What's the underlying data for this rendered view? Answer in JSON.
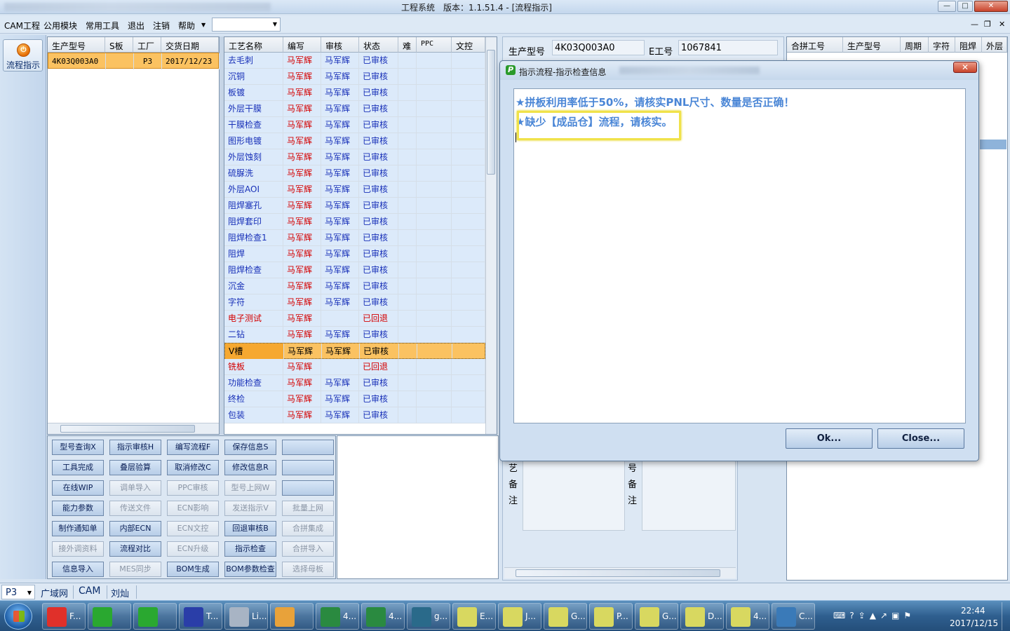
{
  "window": {
    "title": "工程系统　版本：1.1.51.4 - [流程指示]"
  },
  "menu": {
    "items": [
      "CAM工程",
      "公用模块",
      "常用工具",
      "退出",
      "注销",
      "帮助"
    ]
  },
  "sidebar": {
    "flow_label": "流程指示"
  },
  "orders": {
    "headers": [
      "生产型号",
      "S板",
      "工厂",
      "交货日期"
    ],
    "rows": [
      {
        "model": "4K03Q003A0",
        "s": "",
        "factory": "P3",
        "date": "2017/12/23"
      }
    ]
  },
  "process": {
    "headers": [
      "工艺名称",
      "编写",
      "审核",
      "状态",
      "难",
      "PPC",
      "文控"
    ],
    "rows": [
      {
        "name": "去毛刺",
        "writer": "马军辉",
        "reviewer": "马军辉",
        "status": "已审核",
        "red": false
      },
      {
        "name": "沉铜",
        "writer": "马军辉",
        "reviewer": "马军辉",
        "status": "已审核",
        "red": false
      },
      {
        "name": "板镀",
        "writer": "马军辉",
        "reviewer": "马军辉",
        "status": "已审核",
        "red": false
      },
      {
        "name": "外层干膜",
        "writer": "马军辉",
        "reviewer": "马军辉",
        "status": "已审核",
        "red": false
      },
      {
        "name": "干膜检查",
        "writer": "马军辉",
        "reviewer": "马军辉",
        "status": "已审核",
        "red": false
      },
      {
        "name": "图形电镀",
        "writer": "马军辉",
        "reviewer": "马军辉",
        "status": "已审核",
        "red": false
      },
      {
        "name": "外层蚀刻",
        "writer": "马军辉",
        "reviewer": "马军辉",
        "status": "已审核",
        "red": false
      },
      {
        "name": "硫脲洗",
        "writer": "马军辉",
        "reviewer": "马军辉",
        "status": "已审核",
        "red": false
      },
      {
        "name": "外层AOI",
        "writer": "马军辉",
        "reviewer": "马军辉",
        "status": "已审核",
        "red": false
      },
      {
        "name": "阻焊塞孔",
        "writer": "马军辉",
        "reviewer": "马军辉",
        "status": "已审核",
        "red": false
      },
      {
        "name": "阻焊套印",
        "writer": "马军辉",
        "reviewer": "马军辉",
        "status": "已审核",
        "red": false
      },
      {
        "name": "阻焊检查1",
        "writer": "马军辉",
        "reviewer": "马军辉",
        "status": "已审核",
        "red": false
      },
      {
        "name": "阻焊",
        "writer": "马军辉",
        "reviewer": "马军辉",
        "status": "已审核",
        "red": false
      },
      {
        "name": "阻焊检查",
        "writer": "马军辉",
        "reviewer": "马军辉",
        "status": "已审核",
        "red": false
      },
      {
        "name": "沉金",
        "writer": "马军辉",
        "reviewer": "马军辉",
        "status": "已审核",
        "red": false
      },
      {
        "name": "字符",
        "writer": "马军辉",
        "reviewer": "马军辉",
        "status": "已审核",
        "red": false
      },
      {
        "name": "电子测试",
        "writer": "马军辉",
        "reviewer": "",
        "status": "已回退",
        "red": true
      },
      {
        "name": "二钻",
        "writer": "马军辉",
        "reviewer": "马军辉",
        "status": "已审核",
        "red": false
      },
      {
        "name": "V槽",
        "writer": "马军辉",
        "reviewer": "马军辉",
        "status": "已审核",
        "red": false,
        "selected": true
      },
      {
        "name": "铣板",
        "writer": "马军辉",
        "reviewer": "",
        "status": "已回退",
        "red": true
      },
      {
        "name": "功能检查",
        "writer": "马军辉",
        "reviewer": "马军辉",
        "status": "已审核",
        "red": false
      },
      {
        "name": "终检",
        "writer": "马军辉",
        "reviewer": "马军辉",
        "status": "已审核",
        "red": false
      },
      {
        "name": "包装",
        "writer": "马军辉",
        "reviewer": "马军辉",
        "status": "已审核",
        "red": false
      }
    ]
  },
  "buttons": [
    {
      "label": "型号查询X",
      "enabled": true
    },
    {
      "label": "指示审核H",
      "enabled": true
    },
    {
      "label": "编写流程F",
      "enabled": true
    },
    {
      "label": "保存信息S",
      "enabled": true
    },
    {
      "label": "",
      "enabled": true
    },
    {
      "label": "工具完成",
      "enabled": true
    },
    {
      "label": "叠层验算",
      "enabled": true
    },
    {
      "label": "取消修改C",
      "enabled": true
    },
    {
      "label": "修改信息R",
      "enabled": true
    },
    {
      "label": "",
      "enabled": true
    },
    {
      "label": "在线WIP",
      "enabled": true
    },
    {
      "label": "调单导入",
      "enabled": false
    },
    {
      "label": "PPC审核",
      "enabled": false
    },
    {
      "label": "型号上网W",
      "enabled": false
    },
    {
      "label": "",
      "enabled": true
    },
    {
      "label": "能力参数",
      "enabled": true
    },
    {
      "label": "传送文件",
      "enabled": false
    },
    {
      "label": "ECN影响",
      "enabled": false
    },
    {
      "label": "发送指示V",
      "enabled": false
    },
    {
      "label": "批量上网",
      "enabled": false
    },
    {
      "label": "制作通知单",
      "enabled": true
    },
    {
      "label": "内部ECN",
      "enabled": true
    },
    {
      "label": "ECN文控",
      "enabled": false
    },
    {
      "label": "回退审核B",
      "enabled": true
    },
    {
      "label": "合拼集成",
      "enabled": false
    },
    {
      "label": "接外调资料",
      "enabled": false
    },
    {
      "label": "流程对比",
      "enabled": true
    },
    {
      "label": "ECN升级",
      "enabled": false
    },
    {
      "label": "指示检查",
      "enabled": true
    },
    {
      "label": "合拼导入",
      "enabled": false
    },
    {
      "label": "信息导入",
      "enabled": true
    },
    {
      "label": "MES同步",
      "enabled": false
    },
    {
      "label": "BOM生成",
      "enabled": true
    },
    {
      "label": "BOM参数检查",
      "enabled": true
    },
    {
      "label": "选择母板",
      "enabled": false
    }
  ],
  "info": {
    "model_label": "生产型号",
    "model_value": "4K03Q003A0",
    "eno_label": "E工号",
    "eno_value": "1067841"
  },
  "merge": {
    "headers": [
      "合拼工号",
      "生产型号",
      "周期",
      "字符",
      "阻焊",
      "外层"
    ]
  },
  "notes": {
    "label1": "艺备注",
    "label2": "号备注"
  },
  "dialog": {
    "title": "指示流程-指示检查信息",
    "messages": [
      "★拼板利用率低于50%，请核实PNL尺寸、数量是否正确！",
      "★缺少【成品仓】流程，请核实。"
    ],
    "ok_label": "Ok...",
    "close_label": "Close..."
  },
  "status": {
    "factory": "P3",
    "items": [
      "广域网",
      "CAM",
      "刘灿"
    ]
  },
  "taskbar": {
    "apps": [
      "F...",
      "",
      "",
      "T...",
      "Li...",
      "",
      "4...",
      "4...",
      "g...",
      "E...",
      "J...",
      "G...",
      "P...",
      "G...",
      "D...",
      "4...",
      "C..."
    ],
    "time": "22:44",
    "date": "2017/12/15"
  },
  "colors": {
    "selected_row": "#fbc261",
    "link_blue": "#1830b8",
    "rollback_red": "#d40000",
    "dialog_text": "#4a86d6",
    "highlight": "#f0e24a"
  }
}
